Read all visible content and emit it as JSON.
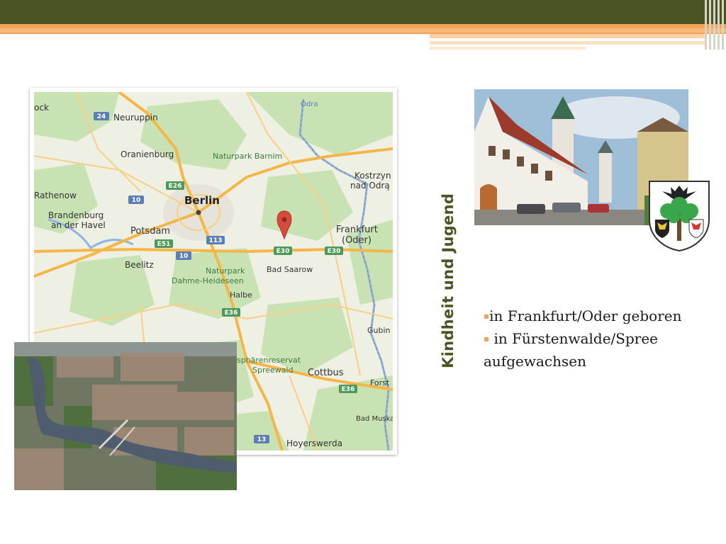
{
  "slide": {
    "title": "Kindheit und Jugend",
    "bullets": [
      {
        "marker": "▪",
        "text": "in Frankfurt/Oder geboren"
      },
      {
        "marker": "▪",
        "text": " in Fürstenwalde/Spree aufgewachsen"
      }
    ]
  },
  "map": {
    "labels": {
      "neuruppin": "Neuruppin",
      "oranienburg": "Oranienburg",
      "barnim": "Naturpark Barnim",
      "kostrzyn": "Kostrzyn",
      "nad_odra": "nad Odrą",
      "odra": "Odra",
      "rathenow": "Rathenow",
      "berlin": "Berlin",
      "brandenburg": "Brandenburg",
      "an_der_havel": "an der Havel",
      "potsdam": "Potsdam",
      "frankfurt": "Frankfurt",
      "oder": "(Oder)",
      "beelitz": "Beelitz",
      "naturpark": "Naturpark",
      "dahme": "Dahme-Heideseen",
      "bad_saarow": "Bad Saarow",
      "halbe": "Halbe",
      "gubin": "Gubin",
      "biosphaere": "sphärenreservat",
      "spreewald": "Spreewald",
      "cottbus": "Cottbus",
      "forst": "Forst",
      "bad_muskau": "Bad Muska",
      "hoyerswerda": "Hoyerswerda",
      "wittstock": "ock"
    },
    "shields": {
      "r24": "24",
      "e26": "E26",
      "r10a": "10",
      "r10b": "10",
      "e51": "E51",
      "r113": "113",
      "e30a": "E30",
      "e30b": "E30",
      "e36a": "E36",
      "e36b": "E36",
      "r13": "13"
    },
    "colors": {
      "land": "#eef0e3",
      "forest": "#c9e2b3",
      "highway": "#f5b648",
      "water": "#8fb6e0",
      "pin": "#d94a3c"
    }
  },
  "photos": {
    "aerial_icon": "aerial-city-photo",
    "town_icon": "town-square-photo",
    "crest_icon": "coat-of-arms"
  }
}
